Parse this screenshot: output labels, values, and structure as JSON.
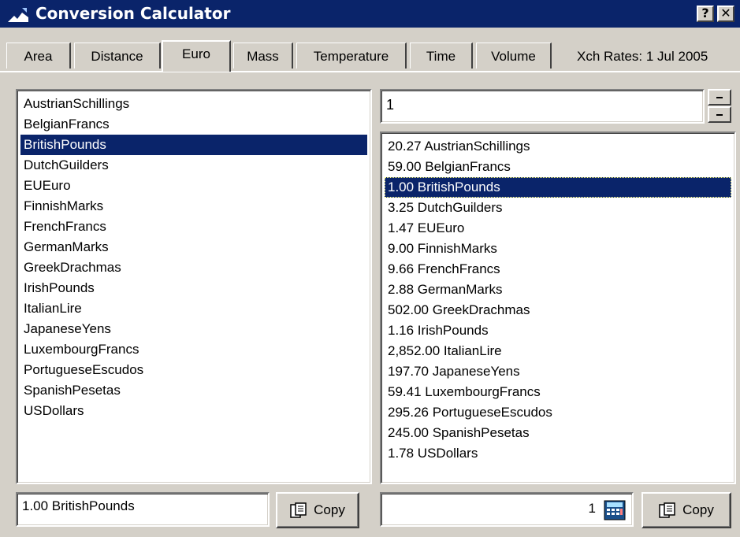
{
  "window": {
    "title": "Conversion Calculator",
    "help_label": "?",
    "close_label": "✕"
  },
  "tabs": [
    {
      "label": "Area"
    },
    {
      "label": "Distance"
    },
    {
      "label": "Euro",
      "active": true
    },
    {
      "label": "Mass"
    },
    {
      "label": "Temperature"
    },
    {
      "label": "Time"
    },
    {
      "label": "Volume"
    }
  ],
  "xch_rates": "Xch Rates: 1 Jul 2005",
  "amount": "1",
  "from_list": [
    "AustrianSchillings",
    "BelgianFrancs",
    "BritishPounds",
    "DutchGuilders",
    "EUEuro",
    "FinnishMarks",
    "FrenchFrancs",
    "GermanMarks",
    "GreekDrachmas",
    "IrishPounds",
    "ItalianLire",
    "JapaneseYens",
    "LuxembourgFrancs",
    "PortugueseEscudos",
    "SpanishPesetas",
    "USDollars"
  ],
  "from_selected_index": 2,
  "to_list": [
    "20.27 AustrianSchillings",
    "59.00 BelgianFrancs",
    "1.00 BritishPounds",
    "3.25 DutchGuilders",
    "1.47 EUEuro",
    "9.00 FinnishMarks",
    "9.66 FrenchFrancs",
    "2.88 GermanMarks",
    "502.00 GreekDrachmas",
    "1.16 IrishPounds",
    "2,852.00 ItalianLire",
    "197.70 JapaneseYens",
    "59.41 LuxembourgFrancs",
    "295.26 PortugueseEscudos",
    "245.00 SpanishPesetas",
    "1.78 USDollars"
  ],
  "to_selected_index": 2,
  "result_left": "1.00 BritishPounds",
  "result_right": "1",
  "copy_label": "Copy",
  "icons": {
    "app": "app-icon",
    "calc": "calculator-icon",
    "copy": "copy-icon",
    "spin_up": "spin-up-icon",
    "spin_down": "spin-down-icon"
  },
  "colors": {
    "title_bg": "#0a246a",
    "face": "#d4d0c8",
    "selection": "#0a246a"
  }
}
